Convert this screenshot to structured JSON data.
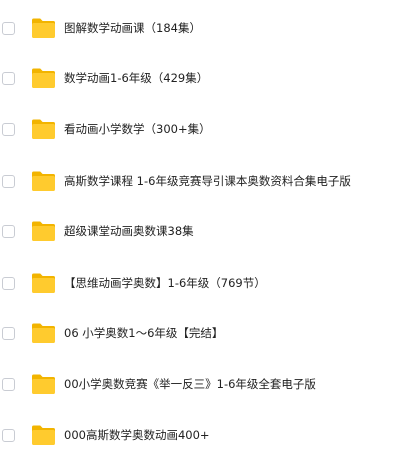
{
  "folder_icon_colors": {
    "back": "#F2B400",
    "front": "#FFCB2E"
  },
  "items": [
    {
      "name": "图解数学动画课（184集）",
      "icon": "folder-icon",
      "checked": false
    },
    {
      "name": "数学动画1-6年级（429集）",
      "icon": "folder-icon",
      "checked": false
    },
    {
      "name": "看动画小学数学（300+集）",
      "icon": "folder-icon",
      "checked": false
    },
    {
      "name": "高斯数学课程 1-6年级竞赛导引课本奥数资料合集电子版",
      "icon": "folder-icon",
      "checked": false
    },
    {
      "name": "超级课堂动画奥数课38集",
      "icon": "folder-icon",
      "checked": false
    },
    {
      "name": "【思维动画学奥数】1-6年级（769节）",
      "icon": "folder-icon",
      "checked": false
    },
    {
      "name": "06 小学奥数1～6年级【完结】",
      "icon": "folder-icon",
      "checked": false
    },
    {
      "name": "00小学奥数竞赛《举一反三》1-6年级全套电子版",
      "icon": "folder-icon",
      "checked": false
    },
    {
      "name": "000高斯数学奥数动画400+",
      "icon": "folder-icon",
      "checked": false
    }
  ]
}
